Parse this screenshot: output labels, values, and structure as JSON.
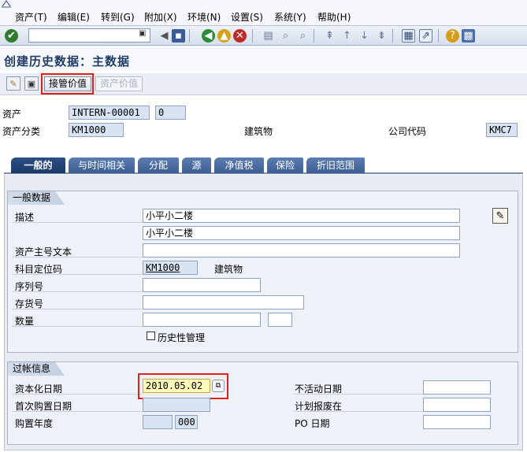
{
  "menu": {
    "items": [
      "资产(T)",
      "编辑(E)",
      "转到(G)",
      "附加(X)",
      "环境(N)",
      "设置(S)",
      "系统(Y)",
      "帮助(H)"
    ]
  },
  "toolbar": {
    "command_value": "",
    "icons": [
      "enter-icon",
      "save-icon",
      "back-icon",
      "exit-icon",
      "cancel-icon",
      "print-icon",
      "find-icon",
      "find-next-icon",
      "first-page-icon",
      "prev-page-icon",
      "next-page-icon",
      "last-page-icon",
      "new-session-icon",
      "shortcut-icon",
      "help-icon",
      "layout-icon"
    ]
  },
  "title": "创建历史数据：主数据",
  "app_toolbar": {
    "takeover_label": "接管价值",
    "asset_values_label": "资产价值"
  },
  "header": {
    "asset_label": "资产",
    "asset_number": "INTERN-00001",
    "sub_number": "0",
    "asset_class_label": "资产分类",
    "asset_class": "KM1000",
    "asset_class_desc": "建筑物",
    "company_code_label": "公司代码",
    "company_code": "KMC7"
  },
  "tabs": [
    "一般的",
    "与时间相关",
    "分配",
    "源",
    "净值税",
    "保险",
    "折旧范围"
  ],
  "general_data": {
    "title": "一般数据",
    "description_label": "描述",
    "description_1": "小平小二楼",
    "description_2": "小平小二楼",
    "main_number_text_label": "资产主号文本",
    "main_number_text": "",
    "account_determination_label": "科目定位码",
    "account_determination": "KM1000",
    "account_determination_desc": "建筑物",
    "serial_number_label": "序列号",
    "serial_number": "",
    "inventory_number_label": "存货号",
    "inventory_number": "",
    "quantity_label": "数量",
    "quantity": "",
    "unit": "",
    "history_mgmt_label": "历史性管理",
    "history_mgmt_checked": false
  },
  "posting_info": {
    "title": "过帐信息",
    "capitalization_date_label": "资本化日期",
    "capitalization_date": "2010.05.02",
    "first_acquisition_label": "首次购置日期",
    "first_acquisition": "",
    "acquisition_year_label": "购置年度",
    "acquisition_year": "",
    "acquisition_period": "000",
    "deactivation_date_label": "不活动日期",
    "deactivation_date": "",
    "planned_retirement_label": "计划报废在",
    "planned_retirement": "",
    "po_date_label": "PO 日期",
    "po_date": ""
  },
  "colors": {
    "highlight": "#e0201b",
    "tab_active": "#1c3968",
    "tab": "#4a6ba0"
  }
}
